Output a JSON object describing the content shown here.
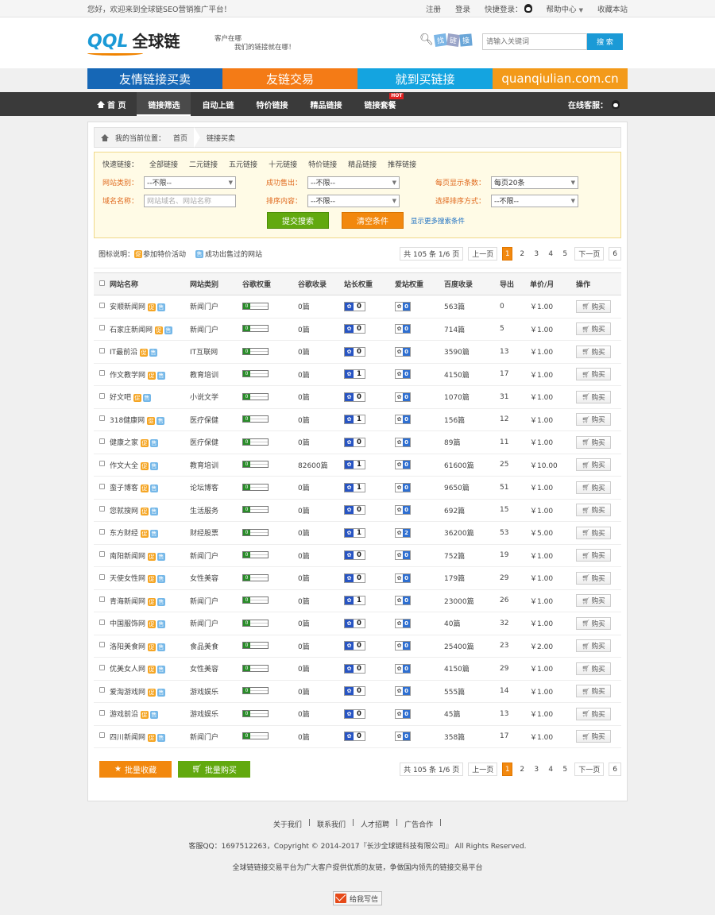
{
  "topbar": {
    "welcome": "您好，欢迎来到全球链SEO营销推广平台！",
    "register": "注册",
    "login": "登录",
    "quick_login": "快捷登录：",
    "help": "帮助中心",
    "favorite": "收藏本站"
  },
  "header": {
    "logo_text": "QQL",
    "logo_cn": "全球链",
    "slogan_1": "客户在哪",
    "slogan_2": "我们的链接就在哪！",
    "find_tags": [
      "找",
      "链",
      "接"
    ],
    "search_placeholder": "请输入关键词",
    "search_button": "搜 索"
  },
  "banners": [
    "友情链接买卖",
    "友链交易",
    "就到买链接",
    "quanqiulian.com.cn"
  ],
  "nav": {
    "items": [
      "首 页",
      "链接筛选",
      "自动上链",
      "特价链接",
      "精品链接",
      "链接套餐"
    ],
    "hot": "HOT",
    "service": "在线客服："
  },
  "breadcrumb": {
    "label": "我的当前位置：",
    "home": "首页",
    "current": "链接买卖"
  },
  "filter": {
    "quick_label": "快速链接：",
    "quick_links": [
      "全部链接",
      "二元链接",
      "五元链接",
      "十元链接",
      "特价链接",
      "精品链接",
      "推荐链接"
    ],
    "site_type_label": "网站类别：",
    "site_type_value": "--不限--",
    "sold_label": "成功售出：",
    "sold_value": "--不限--",
    "per_page_label": "每页显示条数：",
    "per_page_value": "每页20条",
    "name_label": "域名名称：",
    "name_placeholder": "网站域名、网站名称",
    "order_content_label": "排序内容：",
    "order_content_value": "--不限--",
    "order_by_label": "选择排序方式：",
    "order_by_value": "--不限--",
    "submit": "提交搜索",
    "clear": "清空条件",
    "more": "显示更多搜索条件"
  },
  "legend": {
    "label": "图标说明：",
    "cu_icon": "促",
    "cu_text": "参加特价活动",
    "shou_icon": "售",
    "shou_text": "成功出售过的网站"
  },
  "pager": {
    "summary": "共 105 条 1/6 页",
    "prev": "上一页",
    "pages": [
      "1",
      "2",
      "3",
      "4",
      "5"
    ],
    "next": "下一页",
    "last": "6"
  },
  "table": {
    "headers": [
      "网站名称",
      "网站类别",
      "谷歌权重",
      "谷歌收录",
      "站长权重",
      "爱站权重",
      "百度收录",
      "导出",
      "单价/月",
      "操作"
    ],
    "buy_label": "购买",
    "rows": [
      {
        "name": "安顺新闻网",
        "type": "新闻门户",
        "gr": "0",
        "gi": "0篇",
        "bw": "0",
        "aw": "0",
        "bi": "563篇",
        "out": "0",
        "price": "￥1.00"
      },
      {
        "name": "石家庄新闻网",
        "type": "新闻门户",
        "gr": "0",
        "gi": "0篇",
        "bw": "0",
        "aw": "0",
        "bi": "714篇",
        "out": "5",
        "price": "￥1.00"
      },
      {
        "name": "IT最前沿",
        "type": "IT互联网",
        "gr": "0",
        "gi": "0篇",
        "bw": "0",
        "aw": "0",
        "bi": "3590篇",
        "out": "13",
        "price": "￥1.00"
      },
      {
        "name": "作文教学网",
        "type": "教育培训",
        "gr": "0",
        "gi": "0篇",
        "bw": "1",
        "aw": "0",
        "bi": "4150篇",
        "out": "17",
        "price": "￥1.00"
      },
      {
        "name": "好文吧",
        "type": "小说文学",
        "gr": "0",
        "gi": "0篇",
        "bw": "0",
        "aw": "0",
        "bi": "1070篇",
        "out": "31",
        "price": "￥1.00"
      },
      {
        "name": "318健康网",
        "type": "医疗保健",
        "gr": "0",
        "gi": "0篇",
        "bw": "1",
        "aw": "0",
        "bi": "156篇",
        "out": "12",
        "price": "￥1.00"
      },
      {
        "name": "健康之家",
        "type": "医疗保健",
        "gr": "0",
        "gi": "0篇",
        "bw": "0",
        "aw": "0",
        "bi": "89篇",
        "out": "11",
        "price": "￥1.00"
      },
      {
        "name": "作文大全",
        "type": "教育培训",
        "gr": "0",
        "gi": "82600篇",
        "bw": "1",
        "aw": "0",
        "bi": "61600篇",
        "out": "25",
        "price": "￥10.00"
      },
      {
        "name": "蛮子博客",
        "type": "论坛博客",
        "gr": "0",
        "gi": "0篇",
        "bw": "1",
        "aw": "0",
        "bi": "9650篇",
        "out": "51",
        "price": "￥1.00"
      },
      {
        "name": "您就搜网",
        "type": "生活服务",
        "gr": "0",
        "gi": "0篇",
        "bw": "0",
        "aw": "0",
        "bi": "692篇",
        "out": "15",
        "price": "￥1.00"
      },
      {
        "name": "东方财经",
        "type": "财经股票",
        "gr": "0",
        "gi": "0篇",
        "bw": "1",
        "aw": "2",
        "bi": "36200篇",
        "out": "53",
        "price": "￥5.00"
      },
      {
        "name": "南阳新闻网",
        "type": "新闻门户",
        "gr": "0",
        "gi": "0篇",
        "bw": "0",
        "aw": "0",
        "bi": "752篇",
        "out": "19",
        "price": "￥1.00"
      },
      {
        "name": "天使女性网",
        "type": "女性美容",
        "gr": "0",
        "gi": "0篇",
        "bw": "0",
        "aw": "0",
        "bi": "179篇",
        "out": "29",
        "price": "￥1.00"
      },
      {
        "name": "青海新闻网",
        "type": "新闻门户",
        "gr": "0",
        "gi": "0篇",
        "bw": "1",
        "aw": "0",
        "bi": "23000篇",
        "out": "26",
        "price": "￥1.00"
      },
      {
        "name": "中国服饰网",
        "type": "新闻门户",
        "gr": "0",
        "gi": "0篇",
        "bw": "0",
        "aw": "0",
        "bi": "40篇",
        "out": "32",
        "price": "￥1.00"
      },
      {
        "name": "洛阳美食网",
        "type": "食品美食",
        "gr": "0",
        "gi": "0篇",
        "bw": "0",
        "aw": "0",
        "bi": "25400篇",
        "out": "23",
        "price": "￥2.00"
      },
      {
        "name": "优美女人网",
        "type": "女性美容",
        "gr": "0",
        "gi": "0篇",
        "bw": "0",
        "aw": "0",
        "bi": "4150篇",
        "out": "29",
        "price": "￥1.00"
      },
      {
        "name": "爱淘游戏网",
        "type": "游戏娱乐",
        "gr": "0",
        "gi": "0篇",
        "bw": "0",
        "aw": "0",
        "bi": "555篇",
        "out": "14",
        "price": "￥1.00"
      },
      {
        "name": "游戏前沿",
        "type": "游戏娱乐",
        "gr": "0",
        "gi": "0篇",
        "bw": "0",
        "aw": "0",
        "bi": "45篇",
        "out": "13",
        "price": "￥1.00"
      },
      {
        "name": "四川新闻网",
        "type": "新闻门户",
        "gr": "0",
        "gi": "0篇",
        "bw": "0",
        "aw": "0",
        "bi": "358篇",
        "out": "17",
        "price": "￥1.00"
      }
    ]
  },
  "bottom": {
    "batch_fav": "批量收藏",
    "batch_buy": "批量购买"
  },
  "footer": {
    "links": [
      "关于我们",
      "联系我们",
      "人才招聘",
      "广告合作"
    ],
    "copyright": "客服QQ：1697512263，Copyright © 2014-2017『长沙全球链科技有限公司』 All Rights Reserved.",
    "mission": "全球链链接交易平台为广大客户提供优质的友链，争做国内领先的链接交易平台",
    "mail": "给我写信"
  },
  "colors": {
    "accent_blue": "#1b9ad6",
    "accent_orange": "#f2880e",
    "accent_green": "#62a90f",
    "nav_bg": "#3a3a3a"
  }
}
